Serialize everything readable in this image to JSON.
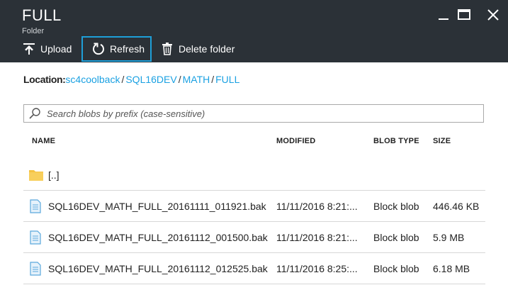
{
  "header": {
    "title": "FULL",
    "subtitle": "Folder",
    "toolbar": {
      "upload_label": "Upload",
      "refresh_label": "Refresh",
      "delete_label": "Delete folder"
    }
  },
  "location": {
    "label": "Location:",
    "path": [
      "sc4coolback",
      "SQL16DEV",
      "MATH",
      "FULL"
    ],
    "separator": "/"
  },
  "search": {
    "placeholder": "Search blobs by prefix (case-sensitive)",
    "value": ""
  },
  "table": {
    "columns": [
      "NAME",
      "MODIFIED",
      "BLOB TYPE",
      "SIZE"
    ],
    "parent_row": {
      "name": "[..]",
      "icon": "folder-icon"
    },
    "rows": [
      {
        "name": "SQL16DEV_MATH_FULL_20161111_011921.bak",
        "modified": "11/11/2016 8:21:...",
        "type": "Block blob",
        "size": "446.46 KB",
        "icon": "file-icon"
      },
      {
        "name": "SQL16DEV_MATH_FULL_20161112_001500.bak",
        "modified": "11/11/2016 8:21:...",
        "type": "Block blob",
        "size": "5.9 MB",
        "icon": "file-icon"
      },
      {
        "name": "SQL16DEV_MATH_FULL_20161112_012525.bak",
        "modified": "11/11/2016 8:25:...",
        "type": "Block blob",
        "size": "6.18 MB",
        "icon": "file-icon"
      }
    ]
  },
  "colors": {
    "header_bg": "#2b3137",
    "accent": "#1ba1e2",
    "focus_border": "#1e9fd8",
    "folder": "#f5c342",
    "file": "#5aa8dc"
  }
}
